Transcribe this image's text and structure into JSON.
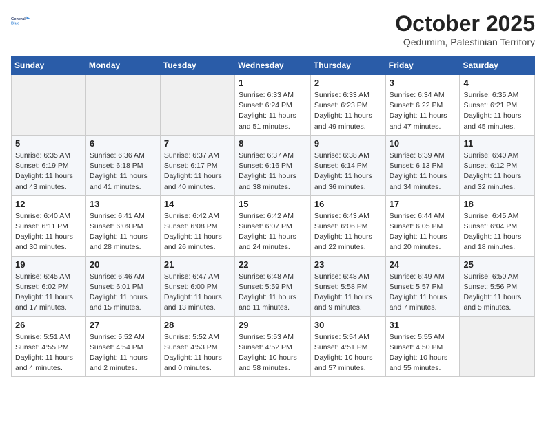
{
  "logo": {
    "line1": "General",
    "line2": "Blue"
  },
  "title": "October 2025",
  "subtitle": "Qedumim, Palestinian Territory",
  "days_of_week": [
    "Sunday",
    "Monday",
    "Tuesday",
    "Wednesday",
    "Thursday",
    "Friday",
    "Saturday"
  ],
  "weeks": [
    [
      {
        "day": "",
        "sunrise": "",
        "sunset": "",
        "daylight": ""
      },
      {
        "day": "",
        "sunrise": "",
        "sunset": "",
        "daylight": ""
      },
      {
        "day": "",
        "sunrise": "",
        "sunset": "",
        "daylight": ""
      },
      {
        "day": "1",
        "sunrise": "Sunrise: 6:33 AM",
        "sunset": "Sunset: 6:24 PM",
        "daylight": "Daylight: 11 hours and 51 minutes."
      },
      {
        "day": "2",
        "sunrise": "Sunrise: 6:33 AM",
        "sunset": "Sunset: 6:23 PM",
        "daylight": "Daylight: 11 hours and 49 minutes."
      },
      {
        "day": "3",
        "sunrise": "Sunrise: 6:34 AM",
        "sunset": "Sunset: 6:22 PM",
        "daylight": "Daylight: 11 hours and 47 minutes."
      },
      {
        "day": "4",
        "sunrise": "Sunrise: 6:35 AM",
        "sunset": "Sunset: 6:21 PM",
        "daylight": "Daylight: 11 hours and 45 minutes."
      }
    ],
    [
      {
        "day": "5",
        "sunrise": "Sunrise: 6:35 AM",
        "sunset": "Sunset: 6:19 PM",
        "daylight": "Daylight: 11 hours and 43 minutes."
      },
      {
        "day": "6",
        "sunrise": "Sunrise: 6:36 AM",
        "sunset": "Sunset: 6:18 PM",
        "daylight": "Daylight: 11 hours and 41 minutes."
      },
      {
        "day": "7",
        "sunrise": "Sunrise: 6:37 AM",
        "sunset": "Sunset: 6:17 PM",
        "daylight": "Daylight: 11 hours and 40 minutes."
      },
      {
        "day": "8",
        "sunrise": "Sunrise: 6:37 AM",
        "sunset": "Sunset: 6:16 PM",
        "daylight": "Daylight: 11 hours and 38 minutes."
      },
      {
        "day": "9",
        "sunrise": "Sunrise: 6:38 AM",
        "sunset": "Sunset: 6:14 PM",
        "daylight": "Daylight: 11 hours and 36 minutes."
      },
      {
        "day": "10",
        "sunrise": "Sunrise: 6:39 AM",
        "sunset": "Sunset: 6:13 PM",
        "daylight": "Daylight: 11 hours and 34 minutes."
      },
      {
        "day": "11",
        "sunrise": "Sunrise: 6:40 AM",
        "sunset": "Sunset: 6:12 PM",
        "daylight": "Daylight: 11 hours and 32 minutes."
      }
    ],
    [
      {
        "day": "12",
        "sunrise": "Sunrise: 6:40 AM",
        "sunset": "Sunset: 6:11 PM",
        "daylight": "Daylight: 11 hours and 30 minutes."
      },
      {
        "day": "13",
        "sunrise": "Sunrise: 6:41 AM",
        "sunset": "Sunset: 6:09 PM",
        "daylight": "Daylight: 11 hours and 28 minutes."
      },
      {
        "day": "14",
        "sunrise": "Sunrise: 6:42 AM",
        "sunset": "Sunset: 6:08 PM",
        "daylight": "Daylight: 11 hours and 26 minutes."
      },
      {
        "day": "15",
        "sunrise": "Sunrise: 6:42 AM",
        "sunset": "Sunset: 6:07 PM",
        "daylight": "Daylight: 11 hours and 24 minutes."
      },
      {
        "day": "16",
        "sunrise": "Sunrise: 6:43 AM",
        "sunset": "Sunset: 6:06 PM",
        "daylight": "Daylight: 11 hours and 22 minutes."
      },
      {
        "day": "17",
        "sunrise": "Sunrise: 6:44 AM",
        "sunset": "Sunset: 6:05 PM",
        "daylight": "Daylight: 11 hours and 20 minutes."
      },
      {
        "day": "18",
        "sunrise": "Sunrise: 6:45 AM",
        "sunset": "Sunset: 6:04 PM",
        "daylight": "Daylight: 11 hours and 18 minutes."
      }
    ],
    [
      {
        "day": "19",
        "sunrise": "Sunrise: 6:45 AM",
        "sunset": "Sunset: 6:02 PM",
        "daylight": "Daylight: 11 hours and 17 minutes."
      },
      {
        "day": "20",
        "sunrise": "Sunrise: 6:46 AM",
        "sunset": "Sunset: 6:01 PM",
        "daylight": "Daylight: 11 hours and 15 minutes."
      },
      {
        "day": "21",
        "sunrise": "Sunrise: 6:47 AM",
        "sunset": "Sunset: 6:00 PM",
        "daylight": "Daylight: 11 hours and 13 minutes."
      },
      {
        "day": "22",
        "sunrise": "Sunrise: 6:48 AM",
        "sunset": "Sunset: 5:59 PM",
        "daylight": "Daylight: 11 hours and 11 minutes."
      },
      {
        "day": "23",
        "sunrise": "Sunrise: 6:48 AM",
        "sunset": "Sunset: 5:58 PM",
        "daylight": "Daylight: 11 hours and 9 minutes."
      },
      {
        "day": "24",
        "sunrise": "Sunrise: 6:49 AM",
        "sunset": "Sunset: 5:57 PM",
        "daylight": "Daylight: 11 hours and 7 minutes."
      },
      {
        "day": "25",
        "sunrise": "Sunrise: 6:50 AM",
        "sunset": "Sunset: 5:56 PM",
        "daylight": "Daylight: 11 hours and 5 minutes."
      }
    ],
    [
      {
        "day": "26",
        "sunrise": "Sunrise: 5:51 AM",
        "sunset": "Sunset: 4:55 PM",
        "daylight": "Daylight: 11 hours and 4 minutes."
      },
      {
        "day": "27",
        "sunrise": "Sunrise: 5:52 AM",
        "sunset": "Sunset: 4:54 PM",
        "daylight": "Daylight: 11 hours and 2 minutes."
      },
      {
        "day": "28",
        "sunrise": "Sunrise: 5:52 AM",
        "sunset": "Sunset: 4:53 PM",
        "daylight": "Daylight: 11 hours and 0 minutes."
      },
      {
        "day": "29",
        "sunrise": "Sunrise: 5:53 AM",
        "sunset": "Sunset: 4:52 PM",
        "daylight": "Daylight: 10 hours and 58 minutes."
      },
      {
        "day": "30",
        "sunrise": "Sunrise: 5:54 AM",
        "sunset": "Sunset: 4:51 PM",
        "daylight": "Daylight: 10 hours and 57 minutes."
      },
      {
        "day": "31",
        "sunrise": "Sunrise: 5:55 AM",
        "sunset": "Sunset: 4:50 PM",
        "daylight": "Daylight: 10 hours and 55 minutes."
      },
      {
        "day": "",
        "sunrise": "",
        "sunset": "",
        "daylight": ""
      }
    ]
  ]
}
